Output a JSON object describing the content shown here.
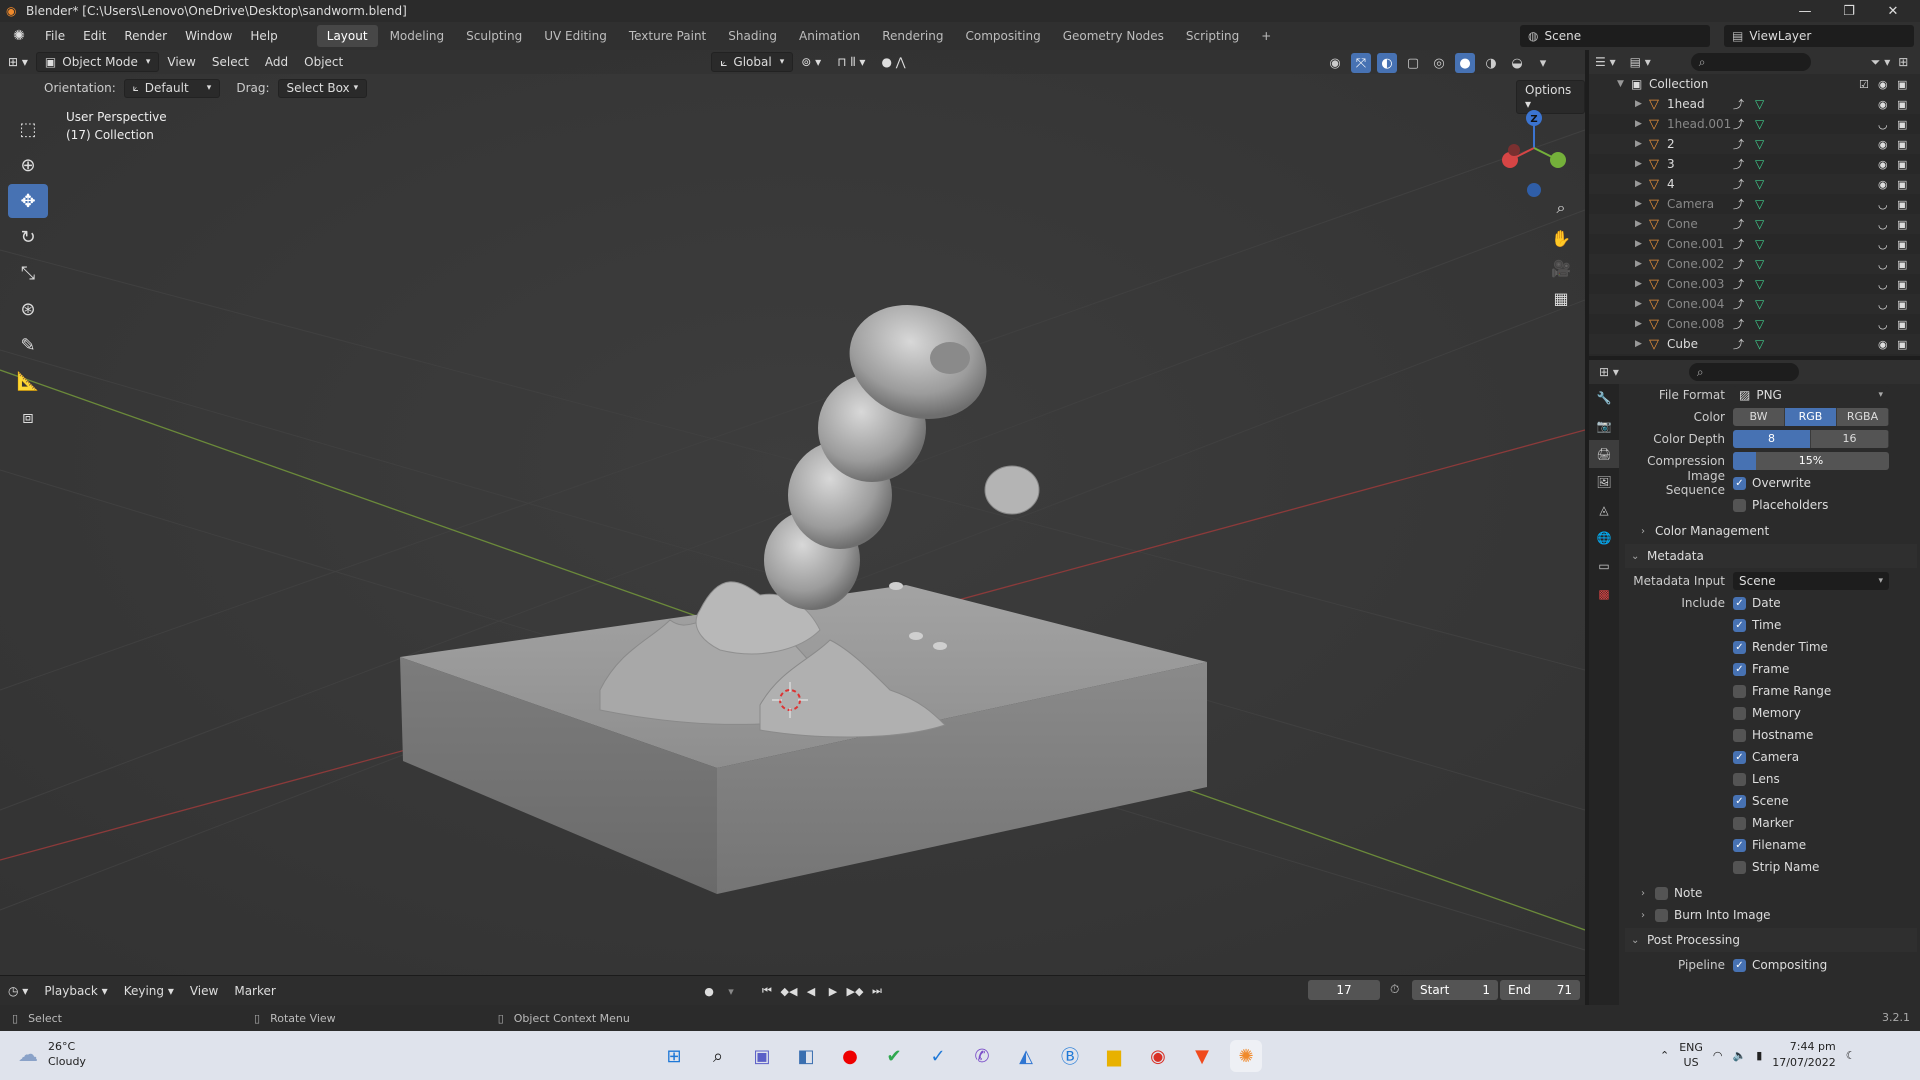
{
  "window": {
    "title": "Blender* [C:\\Users\\Lenovo\\OneDrive\\Desktop\\sandworm.blend]",
    "minimize": "—",
    "maximize": "❐",
    "close": "✕"
  },
  "menu": [
    "File",
    "Edit",
    "Render",
    "Window",
    "Help"
  ],
  "workspaces": [
    "Layout",
    "Modeling",
    "Sculpting",
    "UV Editing",
    "Texture Paint",
    "Shading",
    "Animation",
    "Rendering",
    "Compositing",
    "Geometry Nodes",
    "Scripting"
  ],
  "active_workspace": "Layout",
  "add_workspace": "+",
  "scene": "Scene",
  "view_layer": "ViewLayer",
  "viewport": {
    "mode": "Object Mode",
    "menus": [
      "View",
      "Select",
      "Add",
      "Object"
    ],
    "transform": "Global",
    "orientation_label": "Orientation:",
    "orientation_value": "Default",
    "drag_label": "Drag:",
    "drag_value": "Select Box",
    "options": "Options",
    "info_line1": "User Perspective",
    "info_line2": "(17) Collection"
  },
  "timeline": {
    "menus": [
      "Playback",
      "Keying",
      "View",
      "Marker"
    ],
    "current_frame": "17",
    "start_label": "Start",
    "start": "1",
    "end_label": "End",
    "end": "71"
  },
  "statusbar": {
    "items": [
      "Select",
      "Rotate View",
      "Object Context Menu"
    ],
    "version": "3.2.1"
  },
  "outliner": {
    "collection": "Collection",
    "rows": [
      {
        "name": "1head",
        "dim": false,
        "visible": true
      },
      {
        "name": "1head.001",
        "dim": true,
        "visible": false
      },
      {
        "name": "2",
        "dim": false,
        "visible": true
      },
      {
        "name": "3",
        "dim": false,
        "visible": true
      },
      {
        "name": "4",
        "dim": false,
        "visible": true
      },
      {
        "name": "Camera",
        "dim": true,
        "visible": false
      },
      {
        "name": "Cone",
        "dim": true,
        "visible": false
      },
      {
        "name": "Cone.001",
        "dim": true,
        "visible": false
      },
      {
        "name": "Cone.002",
        "dim": true,
        "visible": false
      },
      {
        "name": "Cone.003",
        "dim": true,
        "visible": false
      },
      {
        "name": "Cone.004",
        "dim": true,
        "visible": false
      },
      {
        "name": "Cone.008",
        "dim": true,
        "visible": false
      },
      {
        "name": "Cube",
        "dim": false,
        "visible": true
      }
    ]
  },
  "properties": {
    "file_format_label": "File Format",
    "file_format": "PNG",
    "color_label": "Color",
    "color_options": [
      "BW",
      "RGB",
      "RGBA"
    ],
    "color_selected": "RGB",
    "color_depth_label": "Color Depth",
    "color_depth_options": [
      "8",
      "16"
    ],
    "color_depth_selected": "8",
    "compression_label": "Compression",
    "compression": "15%",
    "compression_value": 0.15,
    "image_sequence_label": "Image Sequence",
    "overwrite": "Overwrite",
    "placeholders": "Placeholders",
    "color_management": "Color Management",
    "metadata": "Metadata",
    "metadata_input_label": "Metadata Input",
    "metadata_input": "Scene",
    "include_label": "Include",
    "include": [
      {
        "label": "Date",
        "on": true
      },
      {
        "label": "Time",
        "on": true
      },
      {
        "label": "Render Time",
        "on": true
      },
      {
        "label": "Frame",
        "on": true
      },
      {
        "label": "Frame Range",
        "on": false
      },
      {
        "label": "Memory",
        "on": false
      },
      {
        "label": "Hostname",
        "on": false
      },
      {
        "label": "Camera",
        "on": true
      },
      {
        "label": "Lens",
        "on": false
      },
      {
        "label": "Scene",
        "on": true
      },
      {
        "label": "Marker",
        "on": false
      },
      {
        "label": "Filename",
        "on": true
      },
      {
        "label": "Strip Name",
        "on": false
      }
    ],
    "note": "Note",
    "burn": "Burn Into Image",
    "post_processing": "Post Processing",
    "pipeline_label": "Pipeline",
    "compositing": "Compositing"
  },
  "taskbar": {
    "temperature": "26°C",
    "condition": "Cloudy",
    "language": "ENG",
    "region": "US",
    "time": "7:44 pm",
    "date": "17/07/2022"
  }
}
